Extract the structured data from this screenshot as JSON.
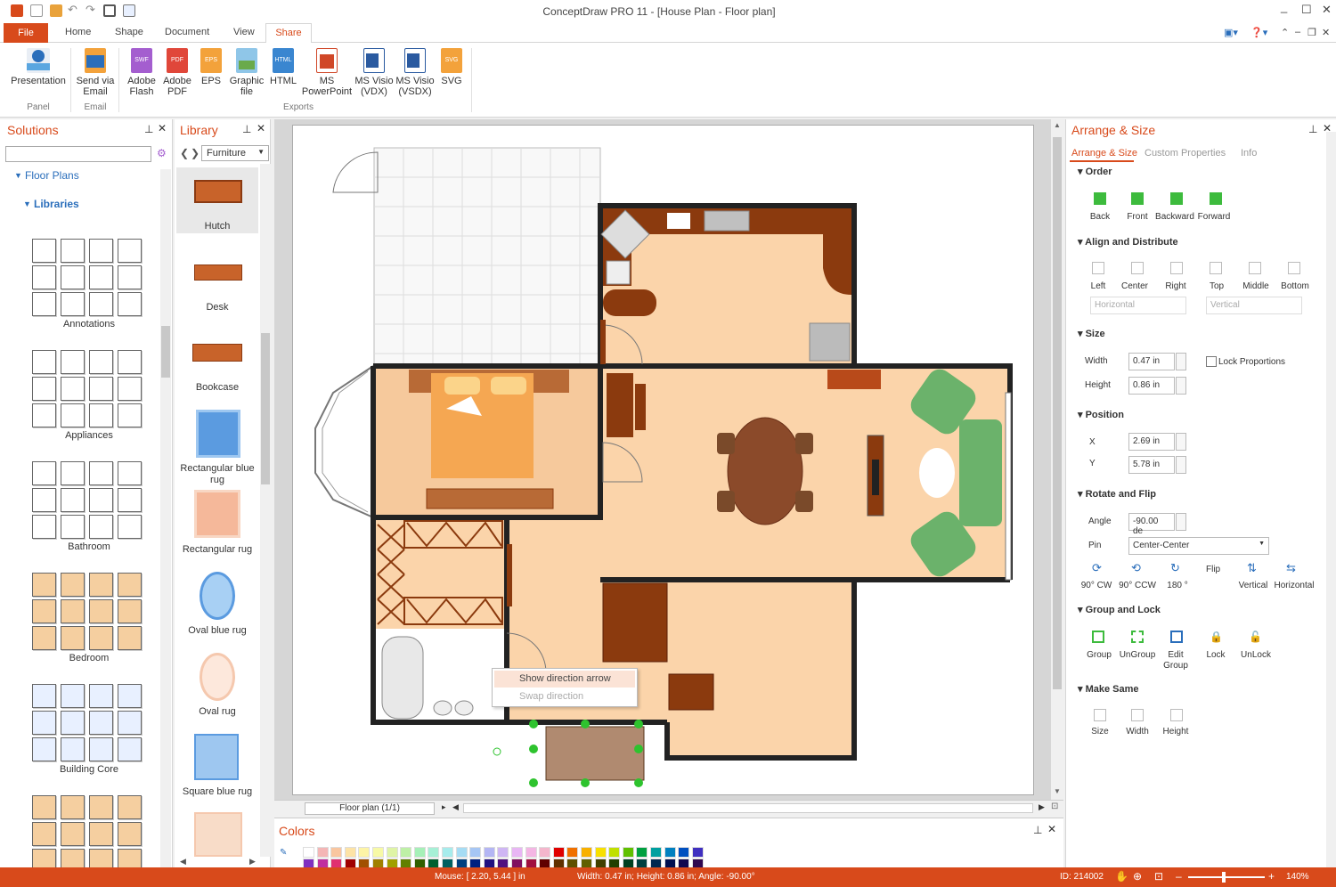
{
  "app": {
    "title": "ConceptDraw PRO 11 - [House Plan - Floor plan]"
  },
  "menu": {
    "file": "File",
    "home": "Home",
    "shape": "Shape",
    "document": "Document",
    "view": "View",
    "share": "Share"
  },
  "ribbon": {
    "presentation": "Presentation",
    "send_email_1": "Send via",
    "send_email_2": "Email",
    "adobe_flash_1": "Adobe",
    "adobe_flash_2": "Flash",
    "adobe_pdf_1": "Adobe",
    "adobe_pdf_2": "PDF",
    "eps": "EPS",
    "graphic_1": "Graphic",
    "graphic_2": "file",
    "html": "HTML",
    "ppt_1": "MS",
    "ppt_2": "PowerPoint",
    "vdx_1": "MS Visio",
    "vdx_2": "(VDX)",
    "vsdx_1": "MS Visio",
    "vsdx_2": "(VSDX)",
    "svg": "SVG",
    "group_panel": "Panel",
    "group_email": "Email",
    "group_exports": "Exports",
    "icon_badges": {
      "swf": "SWF",
      "pdf": "PDF",
      "eps": "EPS",
      "html": "HTML",
      "svg": "SVG"
    }
  },
  "solutions": {
    "title": "Solutions",
    "floor_plans": "Floor Plans",
    "libraries": "Libraries",
    "categories": [
      "Annotations",
      "Appliances",
      "Bathroom",
      "Bedroom",
      "Building Core"
    ]
  },
  "library": {
    "title": "Library",
    "selected": "Furniture",
    "items": [
      "Hutch",
      "Desk",
      "Bookcase",
      "Rectangular blue rug",
      "Rectangular rug",
      "Oval blue rug",
      "Oval rug",
      "Square blue rug"
    ]
  },
  "canvas": {
    "page_tab": "Floor plan (1/1)",
    "context_menu": {
      "show_arrow": "Show direction arrow",
      "swap": "Swap direction"
    }
  },
  "colors_panel": {
    "title": "Colors"
  },
  "arrange": {
    "title": "Arrange & Size",
    "tabs": [
      "Arrange & Size",
      "Custom Properties",
      "Info"
    ],
    "order": {
      "title": "Order",
      "buttons": [
        "Back",
        "Front",
        "Backward",
        "Forward"
      ]
    },
    "align": {
      "title": "Align and Distribute",
      "buttons": [
        "Left",
        "Center",
        "Right",
        "Top",
        "Middle",
        "Bottom"
      ],
      "horizontal": "Horizontal",
      "vertical": "Vertical"
    },
    "size": {
      "title": "Size",
      "width_label": "Width",
      "width": "0.47 in",
      "height_label": "Height",
      "height": "0.86 in",
      "lock": "Lock Proportions"
    },
    "position": {
      "title": "Position",
      "x_label": "X",
      "x": "2.69 in",
      "y_label": "Y",
      "y": "5.78 in"
    },
    "rotate": {
      "title": "Rotate and Flip",
      "angle_label": "Angle",
      "angle": "-90.00 de",
      "pin_label": "Pin",
      "pin": "Center-Center",
      "buttons": [
        "90° CW",
        "90° CCW",
        "180 °",
        "Vertical",
        "Horizontal"
      ],
      "flip": "Flip"
    },
    "group": {
      "title": "Group and Lock",
      "buttons": [
        "Group",
        "UnGroup",
        "Lock",
        "UnLock"
      ],
      "edit_1": "Edit",
      "edit_2": "Group"
    },
    "same": {
      "title": "Make Same",
      "buttons": [
        "Size",
        "Width",
        "Height"
      ]
    }
  },
  "status": {
    "mouse": "Mouse: [ 2.20, 5.44 ] in",
    "dims": "Width: 0.47 in;  Height: 0.86 in;  Angle: -90.00°",
    "id": "ID: 214002",
    "zoom": "140%"
  },
  "palette": [
    "#ffffff",
    "#f4b6b6",
    "#f9c6a0",
    "#fde3a6",
    "#fdf4a6",
    "#f7f9a6",
    "#dff4a6",
    "#bef0a6",
    "#a6f0b8",
    "#a6f0d6",
    "#a6ecec",
    "#a6dcf4",
    "#a6c6f4",
    "#b4b6f4",
    "#cfb6f4",
    "#e8b6f4",
    "#f4b6e4",
    "#f4b6cc",
    "#e00000",
    "#f07000",
    "#f8b000",
    "#f8e000",
    "#c0e000",
    "#60c000",
    "#00a040",
    "#00a0a0",
    "#0080c0",
    "#0050c0",
    "#4030c0",
    "#8030c0",
    "#c030a0",
    "#e03070",
    "#a00000",
    "#a05000",
    "#a08000",
    "#a0a000",
    "#608000",
    "#306000",
    "#006030",
    "#006060",
    "#004080",
    "#002080",
    "#201080",
    "#501080",
    "#801060",
    "#a01040",
    "#600000",
    "#603000",
    "#605000",
    "#606000",
    "#404000",
    "#204000",
    "#004020",
    "#004040",
    "#002850",
    "#001050",
    "#100850",
    "#300850"
  ]
}
